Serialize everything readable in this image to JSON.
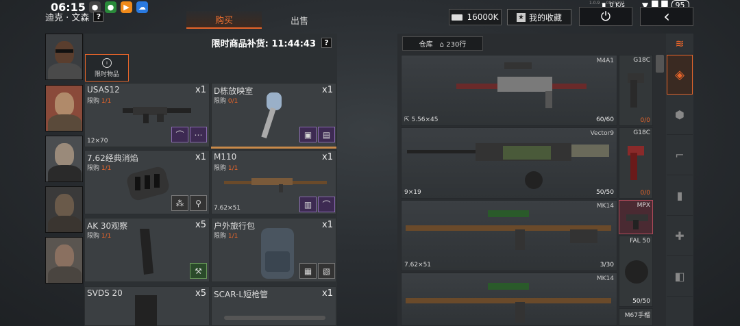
{
  "status_bar": {
    "time": "06:15",
    "net_speed": "0 K/s",
    "battery": "95",
    "app_icons": [
      "gamepad-app-icon",
      "chat-app-icon",
      "video-app-icon",
      "cloud-app-icon"
    ]
  },
  "header": {
    "npc_name": "迪克 · 文森",
    "help": "?",
    "tabs": [
      {
        "label": "购买",
        "active": true
      },
      {
        "label": "出售",
        "active": false
      }
    ],
    "money": "16000K",
    "favorites_label": "我的收藏"
  },
  "shop": {
    "restock_label": "限时商品补货: 11:44:43",
    "help": "?",
    "limited_label": "限时物品",
    "limit_prefix": "限购",
    "items": [
      {
        "name": "USAS12",
        "limit": "1/1",
        "qty": "x1",
        "caliber": "12×70"
      },
      {
        "name": "D栋放映室",
        "limit": "0/1",
        "qty": "x1",
        "caliber": ""
      },
      {
        "name": "7.62经典消焰",
        "limit": "1/1",
        "qty": "x1",
        "caliber": ""
      },
      {
        "name": "M110",
        "limit": "1/1",
        "qty": "x1",
        "caliber": "7.62×51"
      },
      {
        "name": "AK 30观察",
        "limit": "1/1",
        "qty": "x5",
        "caliber": ""
      },
      {
        "name": "户外旅行包",
        "limit": "1/1",
        "qty": "x1",
        "caliber": ""
      },
      {
        "name": "SVDS 20",
        "limit": "",
        "qty": "x5",
        "caliber": ""
      },
      {
        "name": "SCAR-L短枪管",
        "limit": "",
        "qty": "x1",
        "caliber": ""
      }
    ]
  },
  "warehouse": {
    "tab_label": "仓库",
    "rows_label": "230行",
    "weapons": [
      {
        "name": "M4A1",
        "count": "60/60",
        "caliber": "5.56×45"
      },
      {
        "name": "Vector9",
        "count": "50/50",
        "caliber": "9×19"
      },
      {
        "name": "MK14",
        "count": "3/30",
        "caliber": "7.62×51"
      },
      {
        "name": "MK14",
        "count": "",
        "caliber": ""
      }
    ],
    "side_items": [
      {
        "name": "G18C",
        "count": "0/0"
      },
      {
        "name": "G18C",
        "count": "0/0"
      },
      {
        "name": "MPX",
        "count": ""
      },
      {
        "name": "FAL 50",
        "count": "50/50"
      },
      {
        "name": "M67手榴",
        "count": ""
      }
    ]
  },
  "colors": {
    "accent": "#e8652a",
    "limit_red": "#e8652a",
    "purple_slot": "#3d2a52",
    "green_slot": "#2a4a2a"
  }
}
